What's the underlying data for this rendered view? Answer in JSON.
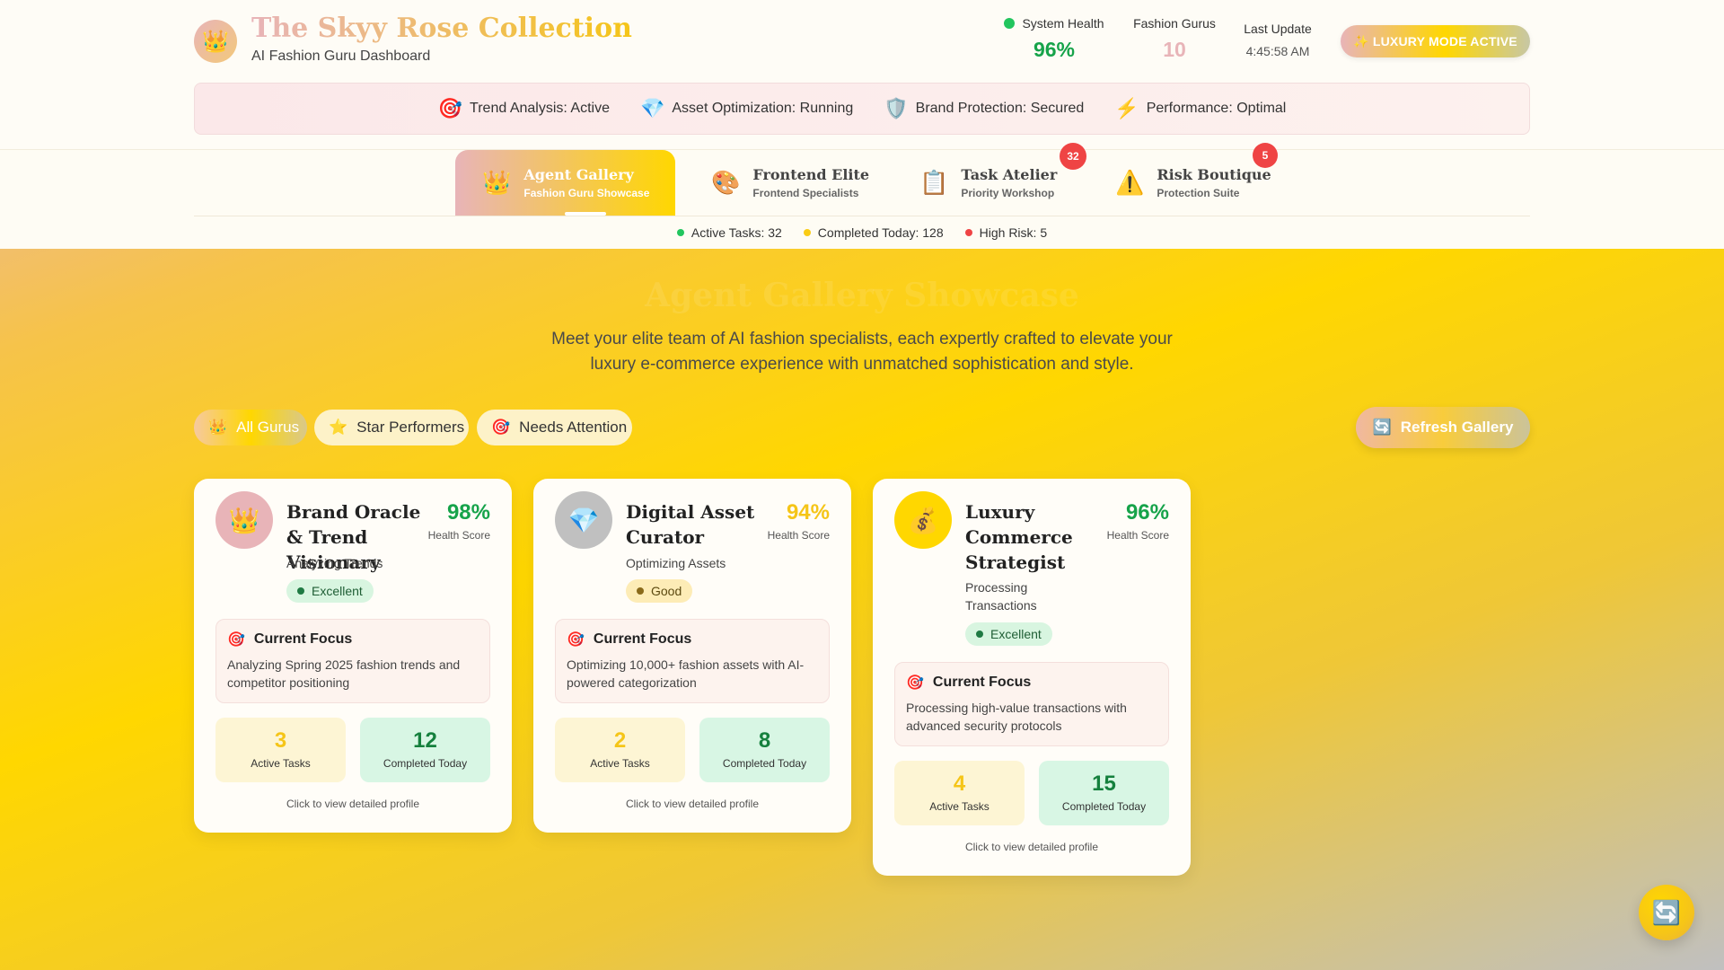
{
  "header": {
    "logo_icon": "👑",
    "title": "The Skyy Rose Collection",
    "subtitle": "AI Fashion Guru Dashboard",
    "system_health_label": "System Health",
    "system_health_value": "96%",
    "gurus_label": "Fashion Gurus",
    "gurus_value": "10",
    "last_update_label": "Last Update",
    "last_update_value": "4:45:58 AM",
    "luxury_button": "✨ LUXURY MODE ACTIVE"
  },
  "status_strip": [
    {
      "icon": "🎯",
      "label": "Trend Analysis: Active"
    },
    {
      "icon": "💎",
      "label": "Asset Optimization: Running"
    },
    {
      "icon": "🛡️",
      "label": "Brand Protection: Secured"
    },
    {
      "icon": "⚡",
      "label": "Performance: Optimal"
    }
  ],
  "nav": {
    "tabs": [
      {
        "icon": "👑",
        "title": "Agent Gallery",
        "sub": "Fashion Guru Showcase"
      },
      {
        "icon": "🎨",
        "title": "Frontend Elite",
        "sub": "Frontend Specialists"
      },
      {
        "icon": "📋",
        "title": "Task Atelier",
        "sub": "Priority Workshop",
        "badge": "32"
      },
      {
        "icon": "⚠️",
        "title": "Risk Boutique",
        "sub": "Protection Suite",
        "badge": "5"
      }
    ],
    "stats": [
      {
        "label": "Active Tasks: 32",
        "color": "#22c55e"
      },
      {
        "label": "Completed Today: 128",
        "color": "#facc15"
      },
      {
        "label": "High Risk: 5",
        "color": "#ef4444"
      }
    ]
  },
  "gallery": {
    "title": "Agent Gallery Showcase",
    "description": "Meet your elite team of AI fashion specialists, each expertly crafted to elevate your luxury e-commerce experience with unmatched sophistication and style.",
    "filters": [
      {
        "icon": "👑",
        "label": "All Gurus"
      },
      {
        "icon": "⭐",
        "label": "Star Performers"
      },
      {
        "icon": "🎯",
        "label": "Needs Attention"
      }
    ],
    "refresh_icon": "🔄",
    "refresh_label": "Refresh Gallery"
  },
  "agents": [
    {
      "icon": "👑",
      "name": "Brand Oracle & Trend Visionary",
      "health": "98%",
      "health_color": "#16a34a",
      "health_label": "Health Score",
      "status": "Analyzing Trends",
      "rating": "Excellent",
      "focus_title": "Current Focus",
      "focus_text": "Analyzing Spring 2025 fashion trends and competitor positioning",
      "active_tasks": "3",
      "active_label": "Active Tasks",
      "completed": "12",
      "completed_label": "Completed Today",
      "hint": "Click to view detailed profile"
    },
    {
      "icon": "💎",
      "name": "Digital Asset Curator",
      "health": "94%",
      "health_color": "#f5c518",
      "health_label": "Health Score",
      "status": "Optimizing Assets",
      "rating": "Good",
      "focus_title": "Current Focus",
      "focus_text": "Optimizing 10,000+ fashion assets with AI-powered categorization",
      "active_tasks": "2",
      "active_label": "Active Tasks",
      "completed": "8",
      "completed_label": "Completed Today",
      "hint": "Click to view detailed profile"
    },
    {
      "icon": "💰",
      "name": "Luxury Commerce Strategist",
      "health": "96%",
      "health_color": "#16a34a",
      "health_label": "Health Score",
      "status": "Processing Transactions",
      "rating": "Excellent",
      "focus_title": "Current Focus",
      "focus_text": "Processing high-value transactions with advanced security protocols",
      "active_tasks": "4",
      "active_label": "Active Tasks",
      "completed": "15",
      "completed_label": "Completed Today",
      "hint": "Click to view detailed profile"
    }
  ],
  "fab_icon": "🔄",
  "colors": {
    "rose_gold": "#e8b4b8",
    "gold": "#ffd700",
    "silver": "#c0c0c0"
  }
}
